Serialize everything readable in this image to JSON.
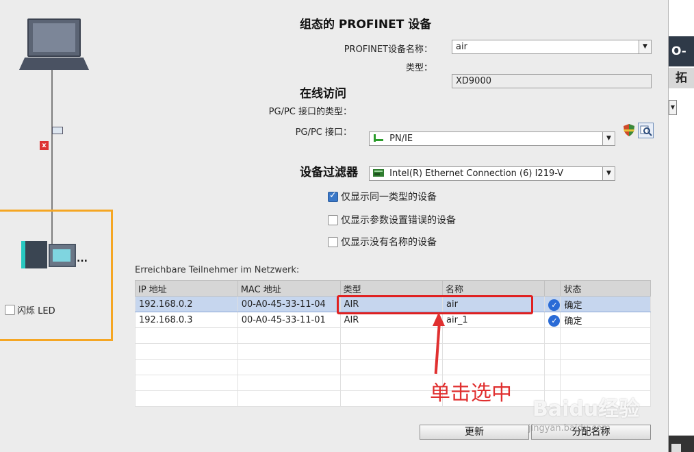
{
  "topology": {
    "led_label": "闪烁 LED",
    "device_ellipsis": "...",
    "error_mark": "x"
  },
  "profinet": {
    "title": "组态的 PROFINET 设备",
    "name_label": "PROFINET设备名称：",
    "name_value": "air",
    "type_label": "类型：",
    "type_value": "XD9000"
  },
  "online": {
    "title": "在线访问",
    "iface_type_label": "PG/PC 接口的类型：",
    "iface_type_value": "PN/IE",
    "iface_label": "PG/PC 接口：",
    "iface_value": "Intel(R) Ethernet Connection (6) I219-V"
  },
  "filter": {
    "title": "设备过滤器",
    "options": [
      {
        "label": "仅显示同一类型的设备",
        "checked": true
      },
      {
        "label": "仅显示参数设置错误的设备",
        "checked": false
      },
      {
        "label": "仅显示没有名称的设备",
        "checked": false
      }
    ]
  },
  "nodes": {
    "caption": "Erreichbare Teilnehmer im Netzwerk:",
    "headers": [
      "IP 地址",
      "MAC 地址",
      "类型",
      "名称",
      "",
      "状态"
    ],
    "rows": [
      {
        "ip": "192.168.0.2",
        "mac": "00-A0-45-33-11-04",
        "type": "AIR",
        "name": "air",
        "status": "确定",
        "selected": true
      },
      {
        "ip": "192.168.0.3",
        "mac": "00-A0-45-33-11-01",
        "type": "AIR",
        "name": "air_1",
        "status": "确定",
        "selected": false
      }
    ]
  },
  "buttons": {
    "refresh": "更新",
    "assign": "分配名称"
  },
  "annotation": {
    "text": "单击选中"
  },
  "right_panel": {
    "title_fragment": "O-Sy",
    "tab_fragment": "拓"
  },
  "watermark": {
    "brand": "Baidu经验",
    "url": "jingyan.baidu.com"
  },
  "colors": {
    "highlight": "#e03030",
    "selection": "#c6d6ee",
    "device_frame": "#f5a623"
  }
}
